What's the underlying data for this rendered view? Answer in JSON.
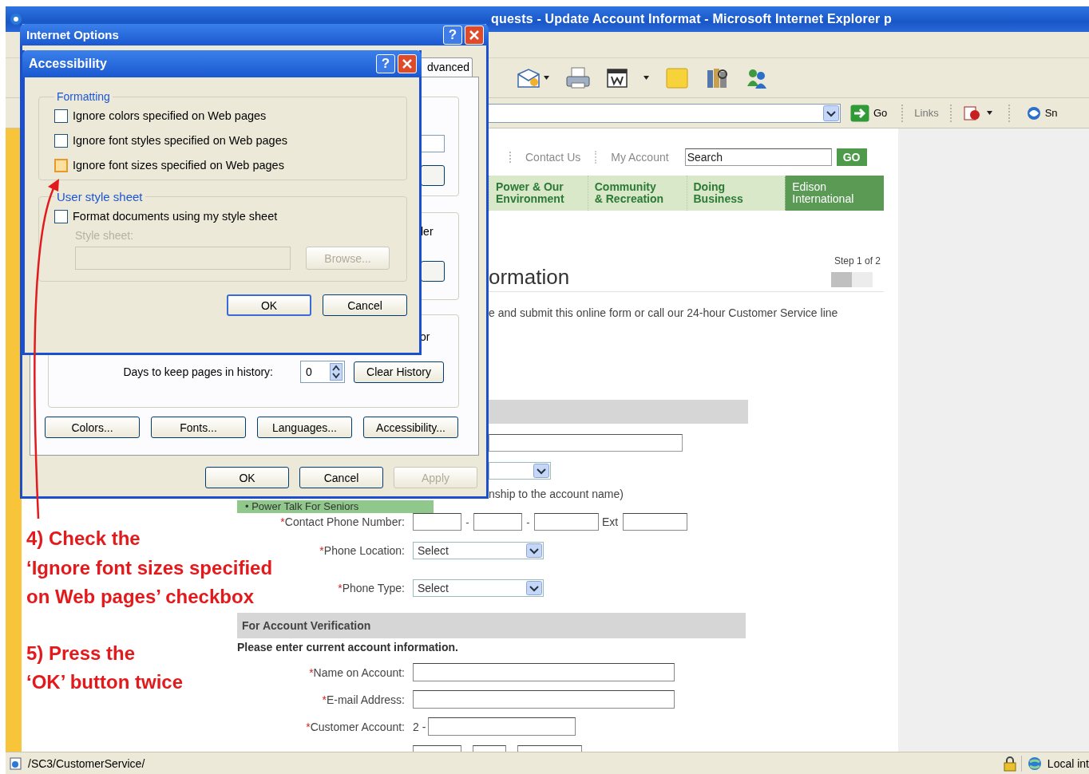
{
  "browser": {
    "title": "quests - Update Account Informat - Microsoft Internet Explorer p",
    "address_bar": {
      "go_label": "Go"
    },
    "links_label": "Links",
    "toolbar_cut_label": "Sn",
    "status_bar": {
      "url": "/SC3/CustomerService/",
      "zone": "Local int"
    }
  },
  "page": {
    "top_links": [
      "Contact Us",
      "My Account"
    ],
    "search": {
      "placeholder": "Search"
    },
    "search_button": "GO",
    "nav_tabs": [
      {
        "label": "Power & Our\nEnvironment",
        "selected": false
      },
      {
        "label": "Community\n& Recreation",
        "selected": false
      },
      {
        "label": "Doing\nBusiness",
        "selected": false
      },
      {
        "label": "Edison\nInternational",
        "selected": true
      }
    ],
    "heading": "ormation",
    "step": {
      "label": "Step 1 of 2",
      "level": 0.5
    },
    "intro": "e and submit this online form or call our 24-hour Customer Service line",
    "relationship_hint": "nship to the account name)",
    "promo": "• Power Talk For Seniors",
    "contact_fields": [
      {
        "kind": "phone",
        "mark": "*",
        "label": "Contact Phone Number:",
        "separators": [
          "-",
          "-"
        ],
        "ext_label": "Ext"
      },
      {
        "kind": "select",
        "mark": "*",
        "label": "Phone Location:",
        "value": "Select"
      },
      {
        "kind": "select",
        "mark": "*",
        "label": "Phone Type:",
        "value": "Select"
      }
    ],
    "section_title": "For Account Verification",
    "section_note": "Please enter current account information.",
    "account_fields": [
      {
        "kind": "text",
        "mark": "*",
        "label": "Name on Account:"
      },
      {
        "kind": "text",
        "mark": "*",
        "label": "E-mail Address:"
      },
      {
        "kind": "account",
        "mark": "*",
        "label": "Customer Account:",
        "prefix": "2 -"
      }
    ]
  },
  "internet_options": {
    "title": "Internet Options",
    "help_glyph": "?",
    "tab": "dvanced",
    "fragments": [
      "ler",
      "or"
    ],
    "history": {
      "label": "Days to keep pages in history:",
      "value": "0"
    },
    "clear_history": "Clear History",
    "buttons": [
      "Colors...",
      "Fonts...",
      "Languages...",
      "Accessibility..."
    ],
    "footer_buttons": [
      {
        "label": "OK",
        "disabled": false
      },
      {
        "label": "Cancel",
        "disabled": false
      },
      {
        "label": "Apply",
        "disabled": true
      }
    ]
  },
  "accessibility": {
    "title": "Accessibility",
    "help_glyph": "?",
    "formatting": {
      "legend": "Formatting",
      "checkboxes": [
        {
          "label": "Ignore colors specified on Web pages",
          "checked": false,
          "highlighted": false
        },
        {
          "label": "Ignore font styles specified on Web pages",
          "checked": false,
          "highlighted": false
        },
        {
          "label": "Ignore font sizes specified on Web pages",
          "checked": false,
          "highlighted": true
        }
      ]
    },
    "user_style_sheet": {
      "legend": "User style sheet",
      "checkbox": {
        "label": "Format documents using my style sheet",
        "checked": false,
        "highlighted": false
      },
      "field_label": "Style sheet:",
      "field_disabled": true,
      "browse": {
        "label": "Browse...",
        "disabled": true
      }
    },
    "buttons": [
      "OK",
      "Cancel"
    ]
  },
  "annotations": [
    {
      "lines": [
        "4)  Check the",
        "‘Ignore font sizes specified",
        "on Web pages’ checkbox"
      ]
    },
    {
      "lines": [
        "5)  Press the",
        "‘OK’ button twice"
      ]
    }
  ]
}
